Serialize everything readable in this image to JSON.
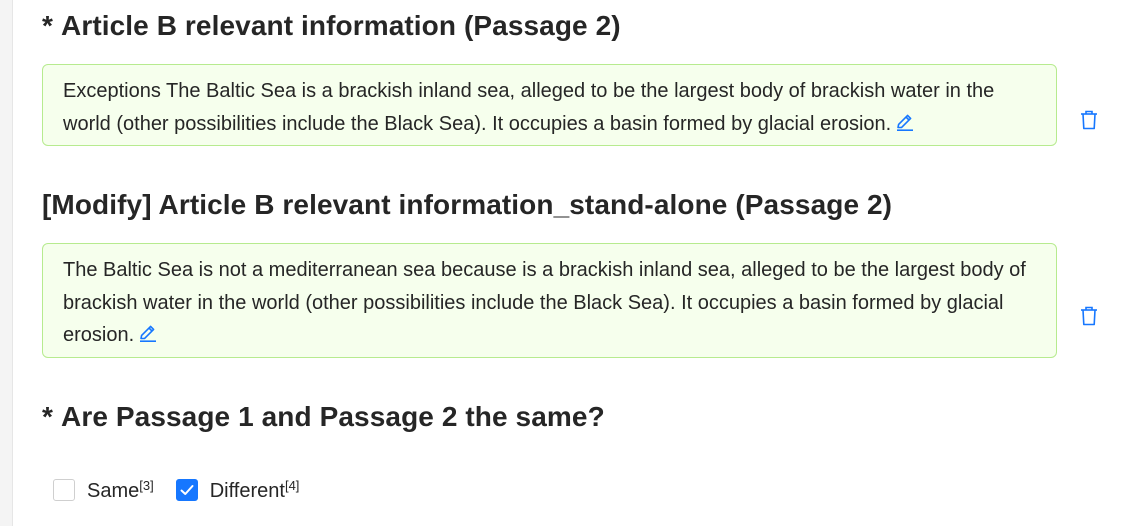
{
  "sections": [
    {
      "required_mark": "*",
      "title": "Article B relevant information (Passage 2)",
      "passage": "Exceptions The Baltic Sea is a brackish inland sea, alleged to be the largest body of brackish water in the world (other possibilities include the Black Sea). It occupies a basin formed by glacial erosion."
    },
    {
      "required_mark": "",
      "title": "[Modify] Article B relevant information_stand-alone (Passage 2)",
      "passage": "The Baltic Sea is not a mediterranean sea because is a brackish inland sea, alleged to be the largest body of brackish water in the world (other possibilities include the Black Sea). It occupies a basin formed by glacial erosion."
    }
  ],
  "question": {
    "required_mark": "*",
    "title": "Are Passage 1 and Passage 2 the same?",
    "options": [
      {
        "label": "Same",
        "ref": "[3]",
        "checked": false
      },
      {
        "label": "Different",
        "ref": "[4]",
        "checked": true
      }
    ]
  },
  "icons": {
    "edit": "pencil-edit-icon",
    "delete": "trash-delete-icon",
    "check": "checkmark-icon"
  },
  "colors": {
    "accent": "#1677ff",
    "passage_bg": "#f6ffed",
    "passage_border": "#b7eb8f"
  }
}
